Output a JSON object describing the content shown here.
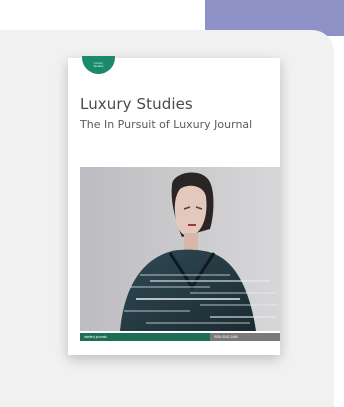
{
  "cover": {
    "badge_line1": "Luxury",
    "badge_line2": "Studies",
    "title": "Luxury Studies",
    "subtitle": "The In Pursuit of Luxury Journal",
    "publisher": "intellect journals",
    "issn": "ISSN 2042-2468"
  },
  "colors": {
    "accent": "#8d91c6",
    "panel": "#f1f1f1",
    "publisher_green": "#1c6e56",
    "badge_green": "#1a8a6a"
  }
}
